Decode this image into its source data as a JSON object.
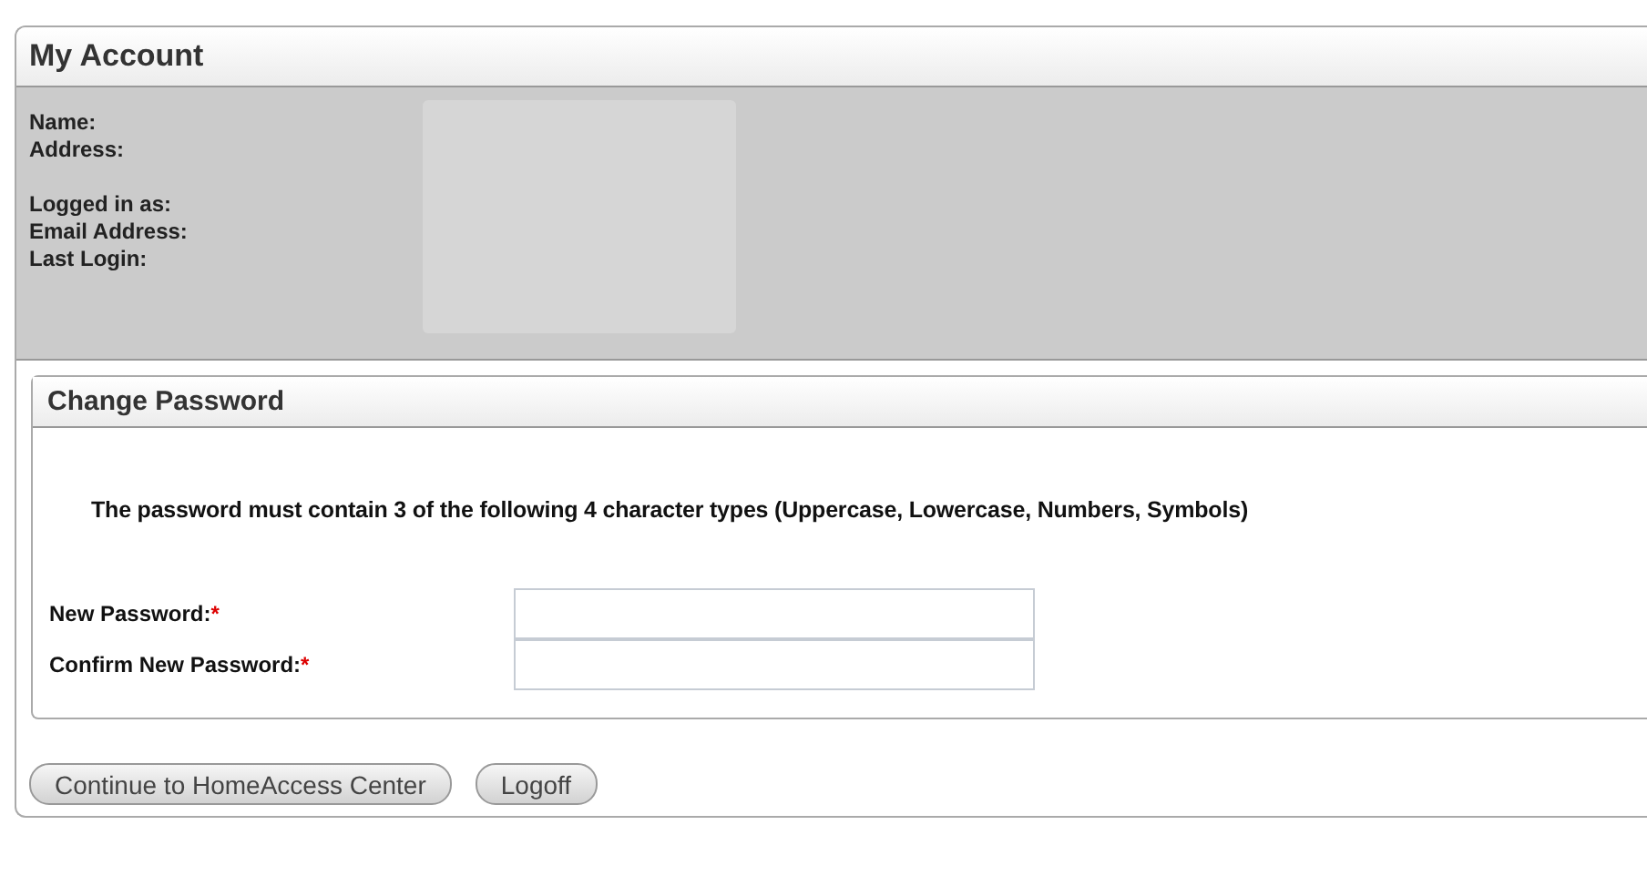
{
  "account": {
    "title": "My Account",
    "label_groups": [
      [
        "Name:",
        "Address:"
      ],
      [
        "Logged in as:",
        "Email Address:",
        "Last Login:"
      ]
    ]
  },
  "change_password": {
    "title": "Change Password",
    "instructions": "The password must contain 3 of the following 4 character types (Uppercase, Lowercase, Numbers, Symbols)",
    "fields": [
      {
        "label": "New Password:",
        "required_mark": "*"
      },
      {
        "label": "Confirm New Password:",
        "required_mark": "*"
      }
    ]
  },
  "buttons": [
    "Continue to HomeAccess Center",
    "Logoff"
  ]
}
